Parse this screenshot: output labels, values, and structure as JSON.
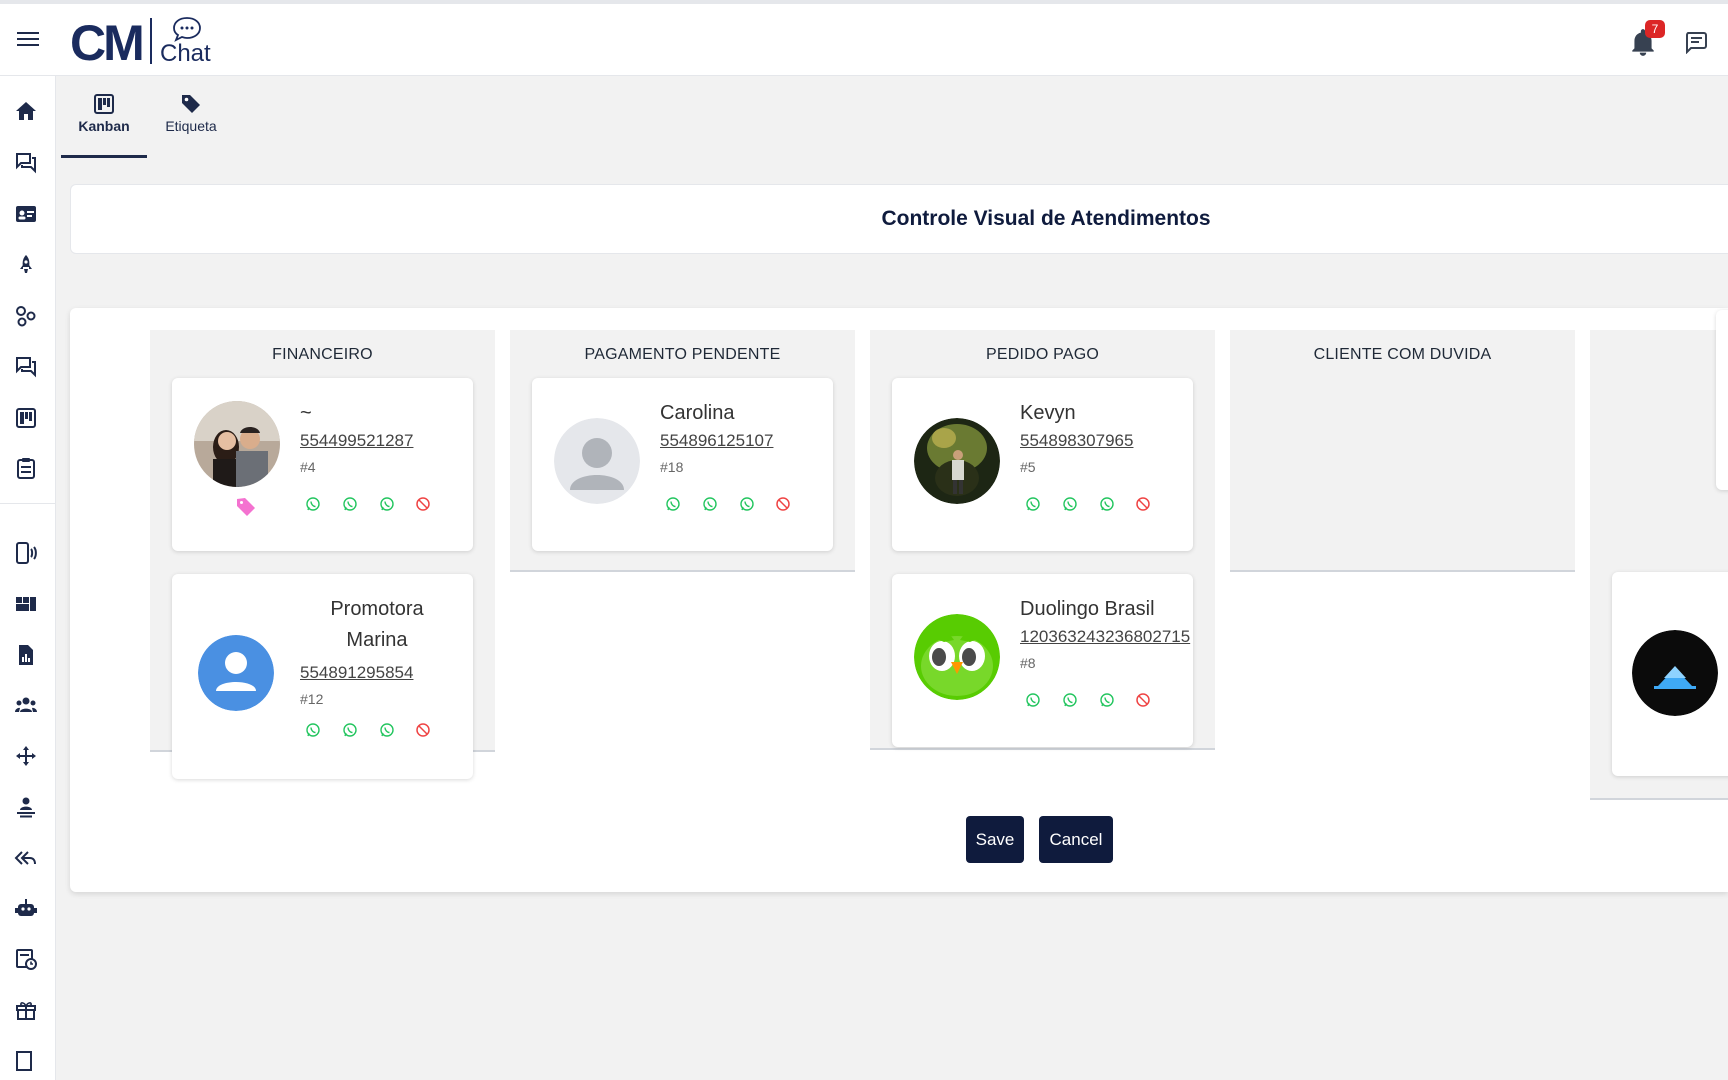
{
  "topbar": {
    "logo_main": "CM",
    "logo_sub": "Chat",
    "notification_count": "7",
    "colors": {
      "brand": "#1a2b5e",
      "badge": "#dc2626"
    }
  },
  "sidebar": {
    "icons": [
      "home-icon",
      "forum-icon",
      "contact-card-icon",
      "rocket-icon",
      "groups-circles-icon",
      "chat-icon",
      "kanban-icon",
      "clipboard-icon",
      "phone-connection-icon",
      "dashboard-icon",
      "report-icon",
      "people-icon",
      "move-icon",
      "user-queue-icon",
      "reply-all-icon",
      "robot-icon",
      "schedule-icon",
      "gift-icon",
      "exit-icon"
    ]
  },
  "tabs": [
    {
      "label": "Kanban",
      "icon": "kanban-icon",
      "active": true
    },
    {
      "label": "Etiqueta",
      "icon": "tag-icon",
      "active": false
    }
  ],
  "page": {
    "title": "Controle Visual de Atendimentos"
  },
  "columns": [
    {
      "title": "FINANCEIRO",
      "cards": [
        {
          "name": "~",
          "phone": "554499521287",
          "id": "#4",
          "avatar": "photo-couple",
          "tag_color": "#f472d0"
        },
        {
          "name": "Promotora Marina",
          "phone": "554891295854",
          "id": "#12",
          "avatar": "default-blue"
        }
      ]
    },
    {
      "title": "PAGAMENTO PENDENTE",
      "cards": [
        {
          "name": "Carolina",
          "phone": "554896125107",
          "id": "#18",
          "avatar": "default-gray"
        }
      ]
    },
    {
      "title": "PEDIDO PAGO",
      "cards": [
        {
          "name": "Kevyn",
          "phone": "554898307965",
          "id": "#5",
          "avatar": "photo-forest"
        },
        {
          "name": "Duolingo Brasil",
          "phone": "120363243236802715",
          "id": "#8",
          "avatar": "owl"
        }
      ]
    },
    {
      "title": "CLIENTE COM DUVIDA",
      "cards": []
    }
  ],
  "actions": {
    "save": "Save",
    "cancel": "Cancel"
  },
  "colors": {
    "whatsapp": "#22c55e",
    "block": "#ef4444",
    "primary": "#0f1b3d"
  }
}
